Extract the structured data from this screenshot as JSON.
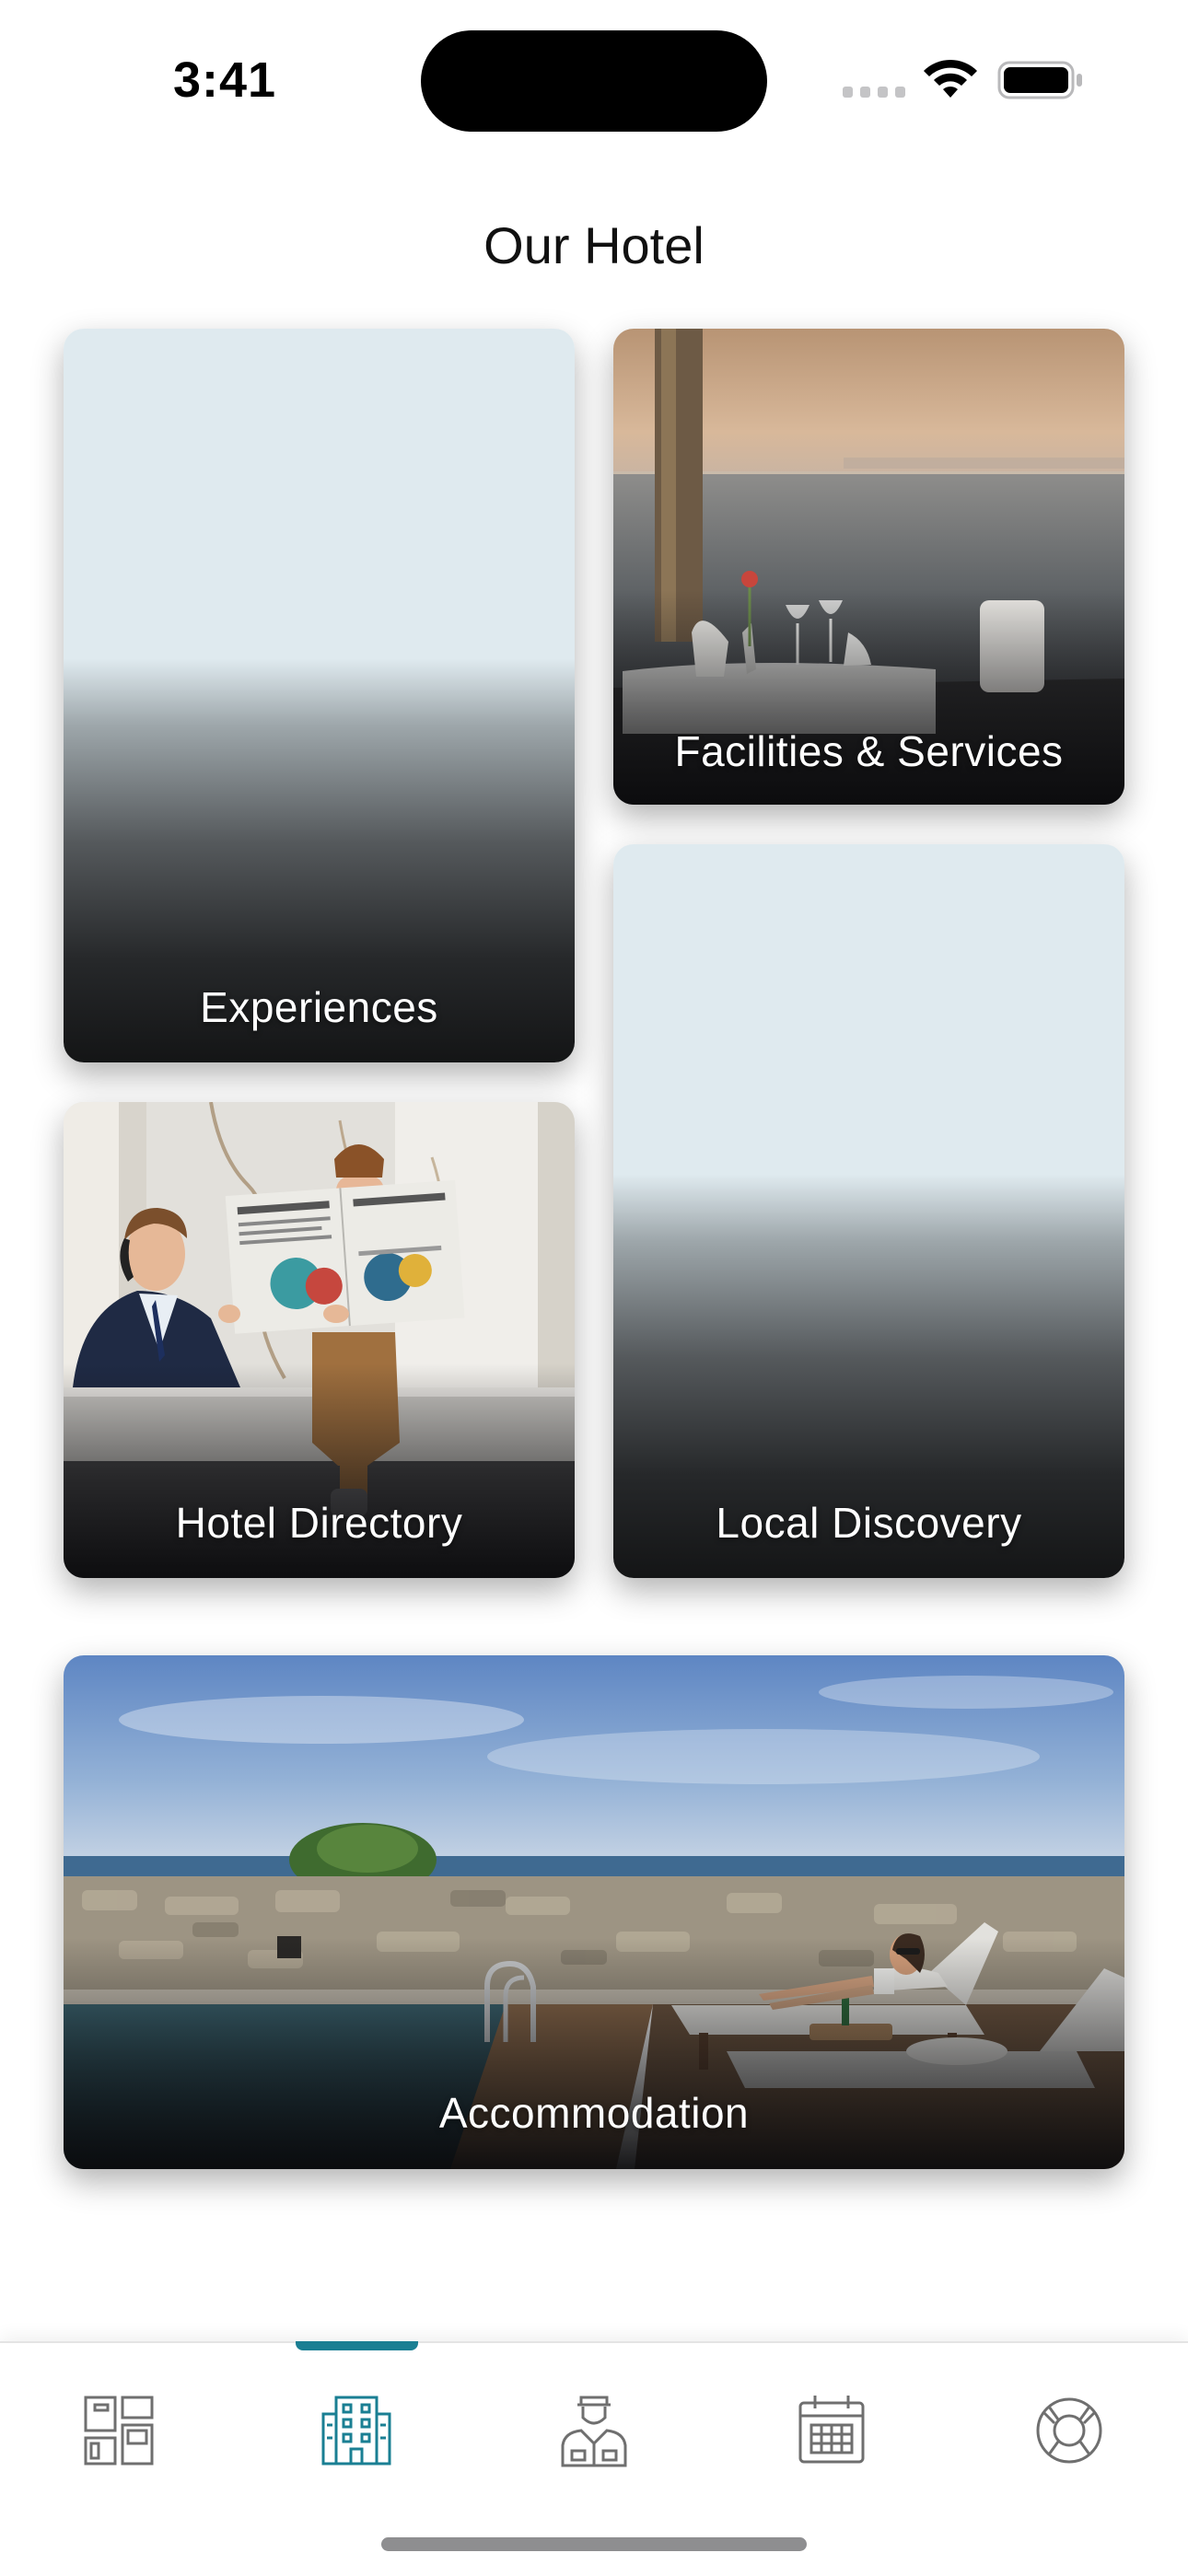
{
  "status_bar": {
    "time": "3:41",
    "icons": [
      "cellular-signal-icon",
      "wifi-icon",
      "battery-icon"
    ]
  },
  "page": {
    "title": "Our Hotel"
  },
  "cards": {
    "experiences": "Experiences",
    "facilities": "Facilities & Services",
    "directory": "Hotel Directory",
    "local": "Local Discovery",
    "accommodation": "Accommodation"
  },
  "tab_bar": {
    "tabs": [
      {
        "icon": "dashboard-icon",
        "selected": false
      },
      {
        "icon": "hotel-building-icon",
        "selected": true
      },
      {
        "icon": "concierge-icon",
        "selected": false
      },
      {
        "icon": "calendar-icon",
        "selected": false
      },
      {
        "icon": "lifebuoy-icon",
        "selected": false
      }
    ],
    "active_color": "#1a7f93",
    "inactive_color": "#6f6f6f"
  }
}
